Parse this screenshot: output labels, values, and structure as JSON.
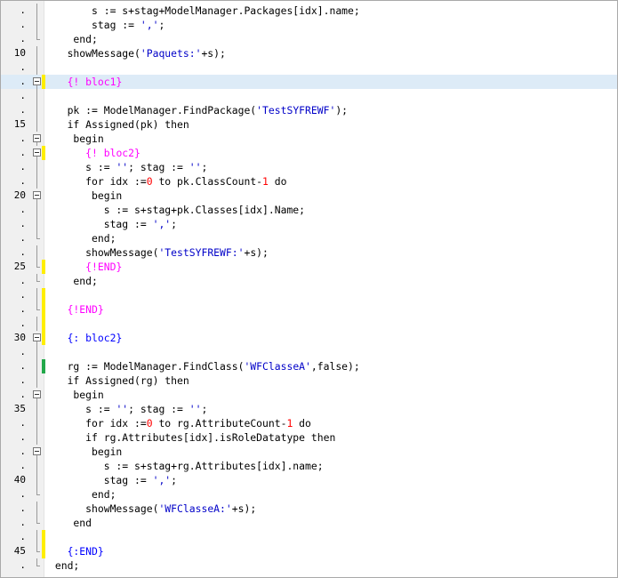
{
  "lines": [
    {
      "n": ".",
      "bar": "",
      "fold": "line",
      "tokens": [
        {
          "t": "       s := s+stag+ModelManager.Packages[idx].name;",
          "c": ""
        }
      ]
    },
    {
      "n": ".",
      "bar": "",
      "fold": "line",
      "tokens": [
        {
          "t": "       stag := ",
          "c": ""
        },
        {
          "t": "','",
          "c": "str"
        },
        {
          "t": ";",
          "c": ""
        }
      ]
    },
    {
      "n": ".",
      "bar": "",
      "fold": "end",
      "tokens": [
        {
          "t": "    end;",
          "c": ""
        }
      ]
    },
    {
      "n": "10",
      "bar": "",
      "fold": "line",
      "tokens": [
        {
          "t": "   showMessage(",
          "c": ""
        },
        {
          "t": "'Paquets:'",
          "c": "str"
        },
        {
          "t": "+s);",
          "c": ""
        }
      ]
    },
    {
      "n": ".",
      "bar": "",
      "fold": "line",
      "tokens": [
        {
          "t": "",
          "c": ""
        }
      ]
    },
    {
      "n": ".",
      "bar": "yellow",
      "fold": "box",
      "hl": true,
      "tokens": [
        {
          "t": "   ",
          "c": ""
        },
        {
          "t": "{! bloc1}",
          "c": "dir"
        }
      ]
    },
    {
      "n": ".",
      "bar": "",
      "fold": "line",
      "tokens": [
        {
          "t": "",
          "c": ""
        }
      ]
    },
    {
      "n": ".",
      "bar": "",
      "fold": "line",
      "tokens": [
        {
          "t": "   pk := ModelManager.FindPackage(",
          "c": ""
        },
        {
          "t": "'TestSYFREWF'",
          "c": "str"
        },
        {
          "t": ");",
          "c": ""
        }
      ]
    },
    {
      "n": "15",
      "bar": "",
      "fold": "line",
      "tokens": [
        {
          "t": "   if Assigned(pk) then",
          "c": ""
        }
      ]
    },
    {
      "n": ".",
      "bar": "",
      "fold": "box",
      "tokens": [
        {
          "t": "    begin",
          "c": ""
        }
      ]
    },
    {
      "n": ".",
      "bar": "yellow",
      "fold": "box",
      "tokens": [
        {
          "t": "      ",
          "c": ""
        },
        {
          "t": "{! bloc2}",
          "c": "dir"
        }
      ]
    },
    {
      "n": ".",
      "bar": "",
      "fold": "line",
      "tokens": [
        {
          "t": "      s := ",
          "c": ""
        },
        {
          "t": "''",
          "c": "str"
        },
        {
          "t": "; stag := ",
          "c": ""
        },
        {
          "t": "''",
          "c": "str"
        },
        {
          "t": ";",
          "c": ""
        }
      ]
    },
    {
      "n": ".",
      "bar": "",
      "fold": "line",
      "tokens": [
        {
          "t": "      for idx :=",
          "c": ""
        },
        {
          "t": "0",
          "c": "num"
        },
        {
          "t": " to pk.ClassCount-",
          "c": ""
        },
        {
          "t": "1",
          "c": "num"
        },
        {
          "t": " do",
          "c": ""
        }
      ]
    },
    {
      "n": "20",
      "bar": "",
      "fold": "box",
      "tokens": [
        {
          "t": "       begin",
          "c": ""
        }
      ]
    },
    {
      "n": ".",
      "bar": "",
      "fold": "line",
      "tokens": [
        {
          "t": "         s := s+stag+pk.Classes[idx].Name;",
          "c": ""
        }
      ]
    },
    {
      "n": ".",
      "bar": "",
      "fold": "line",
      "tokens": [
        {
          "t": "         stag := ",
          "c": ""
        },
        {
          "t": "','",
          "c": "str"
        },
        {
          "t": ";",
          "c": ""
        }
      ]
    },
    {
      "n": ".",
      "bar": "",
      "fold": "end",
      "tokens": [
        {
          "t": "       end;",
          "c": ""
        }
      ]
    },
    {
      "n": ".",
      "bar": "",
      "fold": "line",
      "tokens": [
        {
          "t": "      showMessage(",
          "c": ""
        },
        {
          "t": "'TestSYFREWF:'",
          "c": "str"
        },
        {
          "t": "+s);",
          "c": ""
        }
      ]
    },
    {
      "n": "25",
      "bar": "yellow",
      "fold": "end",
      "tokens": [
        {
          "t": "      ",
          "c": ""
        },
        {
          "t": "{!END}",
          "c": "dir"
        }
      ]
    },
    {
      "n": ".",
      "bar": "",
      "fold": "end",
      "tokens": [
        {
          "t": "    end;",
          "c": ""
        }
      ]
    },
    {
      "n": ".",
      "bar": "yellow",
      "fold": "line",
      "tokens": [
        {
          "t": "",
          "c": ""
        }
      ]
    },
    {
      "n": ".",
      "bar": "yellow",
      "fold": "end",
      "tokens": [
        {
          "t": "   ",
          "c": ""
        },
        {
          "t": "{!END}",
          "c": "dir"
        }
      ]
    },
    {
      "n": ".",
      "bar": "yellow",
      "fold": "line",
      "tokens": [
        {
          "t": "",
          "c": ""
        }
      ]
    },
    {
      "n": "30",
      "bar": "yellow",
      "fold": "box",
      "tokens": [
        {
          "t": "   ",
          "c": ""
        },
        {
          "t": "{: bloc2}",
          "c": "cmt"
        }
      ]
    },
    {
      "n": ".",
      "bar": "",
      "fold": "line",
      "tokens": [
        {
          "t": "",
          "c": ""
        }
      ]
    },
    {
      "n": ".",
      "bar": "green",
      "fold": "line",
      "tokens": [
        {
          "t": "   rg := ModelManager.FindClass(",
          "c": ""
        },
        {
          "t": "'WFClasseA'",
          "c": "str"
        },
        {
          "t": ",false);",
          "c": ""
        }
      ]
    },
    {
      "n": ".",
      "bar": "",
      "fold": "line",
      "tokens": [
        {
          "t": "   if Assigned(rg) then",
          "c": ""
        }
      ]
    },
    {
      "n": ".",
      "bar": "",
      "fold": "box",
      "tokens": [
        {
          "t": "    begin",
          "c": ""
        }
      ]
    },
    {
      "n": "35",
      "bar": "",
      "fold": "line",
      "tokens": [
        {
          "t": "      s := ",
          "c": ""
        },
        {
          "t": "''",
          "c": "str"
        },
        {
          "t": "; stag := ",
          "c": ""
        },
        {
          "t": "''",
          "c": "str"
        },
        {
          "t": ";",
          "c": ""
        }
      ]
    },
    {
      "n": ".",
      "bar": "",
      "fold": "line",
      "tokens": [
        {
          "t": "      for idx :=",
          "c": ""
        },
        {
          "t": "0",
          "c": "num"
        },
        {
          "t": " to rg.AttributeCount-",
          "c": ""
        },
        {
          "t": "1",
          "c": "num"
        },
        {
          "t": " do",
          "c": ""
        }
      ]
    },
    {
      "n": ".",
      "bar": "",
      "fold": "line",
      "tokens": [
        {
          "t": "      if rg.Attributes[idx].isRoleDatatype then",
          "c": ""
        }
      ]
    },
    {
      "n": ".",
      "bar": "",
      "fold": "box",
      "tokens": [
        {
          "t": "       begin",
          "c": ""
        }
      ]
    },
    {
      "n": ".",
      "bar": "",
      "fold": "line",
      "tokens": [
        {
          "t": "         s := s+stag+rg.Attributes[idx].name;",
          "c": ""
        }
      ]
    },
    {
      "n": "40",
      "bar": "",
      "fold": "line",
      "tokens": [
        {
          "t": "         stag := ",
          "c": ""
        },
        {
          "t": "','",
          "c": "str"
        },
        {
          "t": ";",
          "c": ""
        }
      ]
    },
    {
      "n": ".",
      "bar": "",
      "fold": "end",
      "tokens": [
        {
          "t": "       end;",
          "c": ""
        }
      ]
    },
    {
      "n": ".",
      "bar": "",
      "fold": "line",
      "tokens": [
        {
          "t": "      showMessage(",
          "c": ""
        },
        {
          "t": "'WFClasseA:'",
          "c": "str"
        },
        {
          "t": "+s);",
          "c": ""
        }
      ]
    },
    {
      "n": ".",
      "bar": "",
      "fold": "end",
      "tokens": [
        {
          "t": "    end",
          "c": ""
        }
      ]
    },
    {
      "n": ".",
      "bar": "yellow",
      "fold": "line",
      "tokens": [
        {
          "t": "",
          "c": ""
        }
      ]
    },
    {
      "n": "45",
      "bar": "yellow",
      "fold": "end",
      "tokens": [
        {
          "t": "   ",
          "c": ""
        },
        {
          "t": "{:END}",
          "c": "cmt"
        }
      ]
    },
    {
      "n": ".",
      "bar": "",
      "fold": "end",
      "tokens": [
        {
          "t": " end;",
          "c": ""
        }
      ]
    }
  ],
  "colors": {
    "keyword": "#000080",
    "string": "#0000c8",
    "number": "#ff0000",
    "directive": "#ff00ff",
    "comment": "#0000ff",
    "highlight": "#ddebf7",
    "modified_bar": "#ffee00",
    "saved_bar": "#22a84a"
  }
}
